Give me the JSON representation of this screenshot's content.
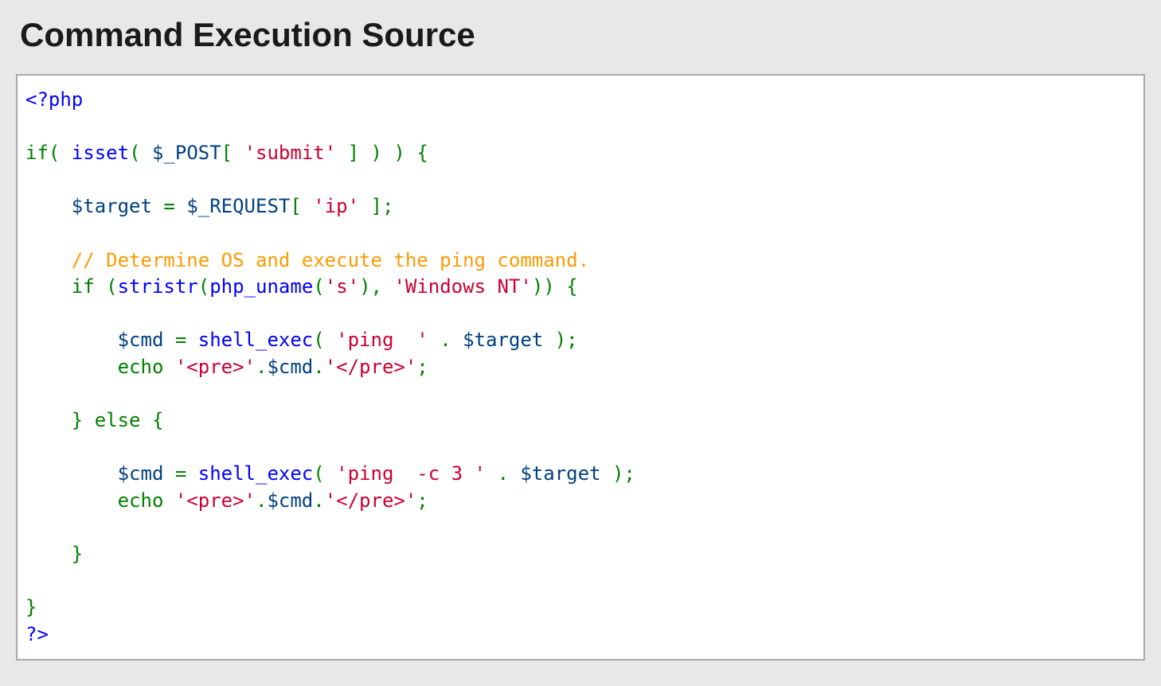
{
  "header": {
    "title": "Command Execution Source"
  },
  "code": {
    "tokens": [
      {
        "cls": "t-phptag",
        "text": "<?php"
      },
      {
        "cls": "",
        "text": "\n\n"
      },
      {
        "cls": "t-keyword",
        "text": "if"
      },
      {
        "cls": "t-paren",
        "text": "( "
      },
      {
        "cls": "t-func",
        "text": "isset"
      },
      {
        "cls": "t-paren",
        "text": "( "
      },
      {
        "cls": "t-var",
        "text": "$_POST"
      },
      {
        "cls": "t-paren",
        "text": "[ "
      },
      {
        "cls": "t-string",
        "text": "'submit'"
      },
      {
        "cls": "t-paren",
        "text": " ] ) ) {"
      },
      {
        "cls": "",
        "text": "\n\n    "
      },
      {
        "cls": "t-var",
        "text": "$target"
      },
      {
        "cls": "t-punct",
        "text": " = "
      },
      {
        "cls": "t-var",
        "text": "$_REQUEST"
      },
      {
        "cls": "t-paren",
        "text": "[ "
      },
      {
        "cls": "t-string",
        "text": "'ip'"
      },
      {
        "cls": "t-paren",
        "text": " ];"
      },
      {
        "cls": "",
        "text": "\n\n    "
      },
      {
        "cls": "t-comment",
        "text": "// Determine OS and execute the ping command."
      },
      {
        "cls": "",
        "text": "\n    "
      },
      {
        "cls": "t-keyword",
        "text": "if"
      },
      {
        "cls": "t-plain",
        "text": " "
      },
      {
        "cls": "t-paren",
        "text": "("
      },
      {
        "cls": "t-func",
        "text": "stristr"
      },
      {
        "cls": "t-paren",
        "text": "("
      },
      {
        "cls": "t-func",
        "text": "php_uname"
      },
      {
        "cls": "t-paren",
        "text": "("
      },
      {
        "cls": "t-string",
        "text": "'s'"
      },
      {
        "cls": "t-paren",
        "text": "), "
      },
      {
        "cls": "t-string",
        "text": "'Windows NT'"
      },
      {
        "cls": "t-paren",
        "text": ")) {"
      },
      {
        "cls": "",
        "text": "\n    \n        "
      },
      {
        "cls": "t-var",
        "text": "$cmd"
      },
      {
        "cls": "t-punct",
        "text": " = "
      },
      {
        "cls": "t-func",
        "text": "shell_exec"
      },
      {
        "cls": "t-paren",
        "text": "( "
      },
      {
        "cls": "t-string",
        "text": "'ping  '"
      },
      {
        "cls": "t-punct",
        "text": " . "
      },
      {
        "cls": "t-var",
        "text": "$target"
      },
      {
        "cls": "t-paren",
        "text": " );"
      },
      {
        "cls": "",
        "text": "\n        "
      },
      {
        "cls": "t-keyword",
        "text": "echo"
      },
      {
        "cls": "t-plain",
        "text": " "
      },
      {
        "cls": "t-string",
        "text": "'<pre>'"
      },
      {
        "cls": "t-punct",
        "text": "."
      },
      {
        "cls": "t-var",
        "text": "$cmd"
      },
      {
        "cls": "t-punct",
        "text": "."
      },
      {
        "cls": "t-string",
        "text": "'</pre>'"
      },
      {
        "cls": "t-punct",
        "text": ";"
      },
      {
        "cls": "",
        "text": "\n    \n    "
      },
      {
        "cls": "t-paren",
        "text": "}"
      },
      {
        "cls": "t-plain",
        "text": " "
      },
      {
        "cls": "t-keyword",
        "text": "else"
      },
      {
        "cls": "t-plain",
        "text": " "
      },
      {
        "cls": "t-paren",
        "text": "{"
      },
      {
        "cls": "",
        "text": "\n    \n        "
      },
      {
        "cls": "t-var",
        "text": "$cmd"
      },
      {
        "cls": "t-punct",
        "text": " = "
      },
      {
        "cls": "t-func",
        "text": "shell_exec"
      },
      {
        "cls": "t-paren",
        "text": "( "
      },
      {
        "cls": "t-string",
        "text": "'ping  -c 3 '"
      },
      {
        "cls": "t-punct",
        "text": " . "
      },
      {
        "cls": "t-var",
        "text": "$target"
      },
      {
        "cls": "t-paren",
        "text": " );"
      },
      {
        "cls": "",
        "text": "\n        "
      },
      {
        "cls": "t-keyword",
        "text": "echo"
      },
      {
        "cls": "t-plain",
        "text": " "
      },
      {
        "cls": "t-string",
        "text": "'<pre>'"
      },
      {
        "cls": "t-punct",
        "text": "."
      },
      {
        "cls": "t-var",
        "text": "$cmd"
      },
      {
        "cls": "t-punct",
        "text": "."
      },
      {
        "cls": "t-string",
        "text": "'</pre>'"
      },
      {
        "cls": "t-punct",
        "text": ";"
      },
      {
        "cls": "",
        "text": "\n        \n    "
      },
      {
        "cls": "t-paren",
        "text": "}"
      },
      {
        "cls": "",
        "text": "\n    \n"
      },
      {
        "cls": "t-paren",
        "text": "}"
      },
      {
        "cls": "",
        "text": "\n"
      },
      {
        "cls": "t-phptag",
        "text": "?>"
      }
    ]
  }
}
